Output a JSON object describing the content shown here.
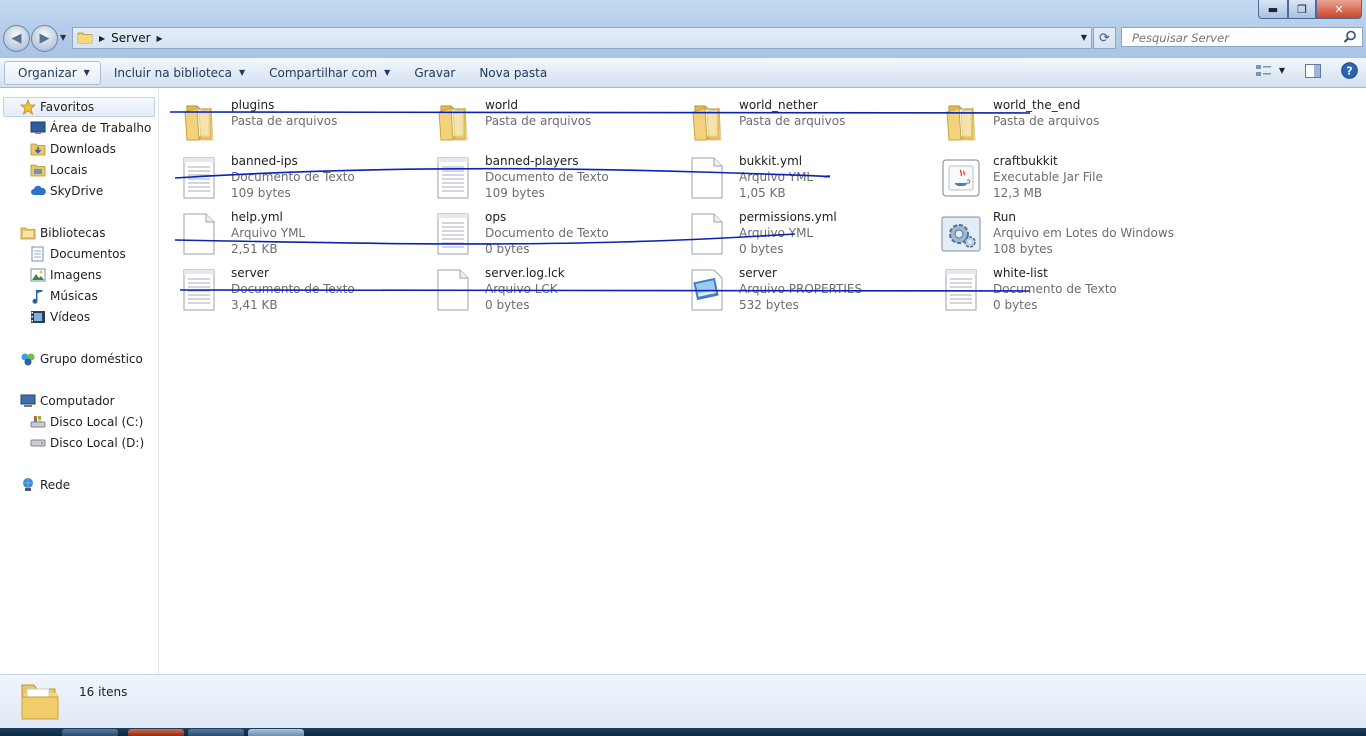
{
  "window": {
    "controls": {
      "minimize": "▬",
      "maximize": "❐",
      "close": "✕"
    }
  },
  "address": {
    "path": [
      "Server"
    ],
    "search_placeholder": "Pesquisar Server"
  },
  "toolbar": {
    "organize": "Organizar",
    "include": "Incluir na biblioteca",
    "share": "Compartilhar com",
    "burn": "Gravar",
    "new_folder": "Nova pasta"
  },
  "nav": {
    "favorites": "Favoritos",
    "desktop": "Área de Trabalho",
    "downloads": "Downloads",
    "places": "Locais",
    "skydrive": "SkyDrive",
    "libraries": "Bibliotecas",
    "documents": "Documentos",
    "images": "Imagens",
    "music": "Músicas",
    "videos": "Vídeos",
    "homegroup": "Grupo doméstico",
    "computer": "Computador",
    "disk_c": "Disco Local (C:)",
    "disk_d": "Disco Local (D:)",
    "network": "Rede"
  },
  "files": [
    {
      "name": "plugins",
      "type": "Pasta de arquivos",
      "size": "",
      "icon": "folder"
    },
    {
      "name": "world",
      "type": "Pasta de arquivos",
      "size": "",
      "icon": "folder"
    },
    {
      "name": "world_nether",
      "type": "Pasta de arquivos",
      "size": "",
      "icon": "folder"
    },
    {
      "name": "world_the_end",
      "type": "Pasta de arquivos",
      "size": "",
      "icon": "folder"
    },
    {
      "name": "banned-ips",
      "type": "Documento de Texto",
      "size": "109 bytes",
      "icon": "text-doc"
    },
    {
      "name": "banned-players",
      "type": "Documento de Texto",
      "size": "109 bytes",
      "icon": "text-doc"
    },
    {
      "name": "bukkit.yml",
      "type": "Arquivo YML",
      "size": "1,05 KB",
      "icon": "blank-doc"
    },
    {
      "name": "craftbukkit",
      "type": "Executable Jar File",
      "size": "12,3 MB",
      "icon": "java-jar"
    },
    {
      "name": "help.yml",
      "type": "Arquivo YML",
      "size": "2,51 KB",
      "icon": "blank-doc"
    },
    {
      "name": "ops",
      "type": "Documento de Texto",
      "size": "0 bytes",
      "icon": "text-doc"
    },
    {
      "name": "permissions.yml",
      "type": "Arquivo YML",
      "size": "0 bytes",
      "icon": "blank-doc"
    },
    {
      "name": "Run",
      "type": "Arquivo em Lotes do Windows",
      "size": "108 bytes",
      "icon": "batch-gear"
    },
    {
      "name": "server",
      "type": "Documento de Texto",
      "size": "3,41 KB",
      "icon": "text-doc"
    },
    {
      "name": "server.log.lck",
      "type": "Arquivo LCK",
      "size": "0 bytes",
      "icon": "blank-doc"
    },
    {
      "name": "server",
      "type": "Arquivo PROPERTIES",
      "size": "532 bytes",
      "icon": "properties-doc"
    },
    {
      "name": "white-list",
      "type": "Documento de Texto",
      "size": "0 bytes",
      "icon": "text-doc"
    }
  ],
  "status": {
    "count": "16 itens"
  },
  "colors": {
    "accent": "#1e395b",
    "scribble": "#0a22b5"
  }
}
